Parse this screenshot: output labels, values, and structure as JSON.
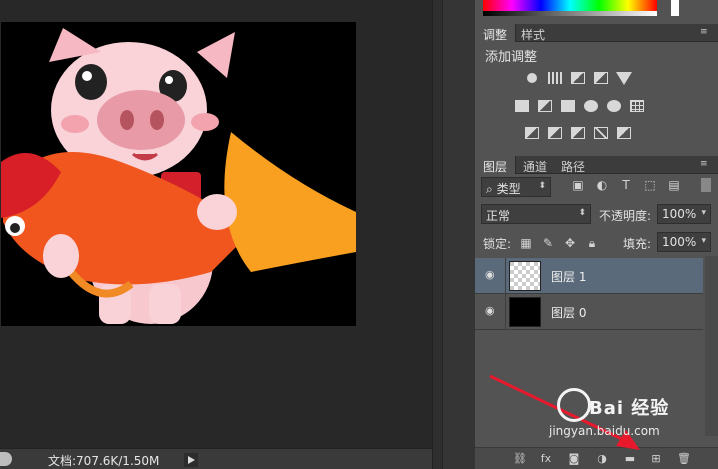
{
  "document": {
    "status_text": "文档:707.6K/1.50M"
  },
  "adjustments_panel": {
    "tabs": [
      {
        "label": "调整"
      },
      {
        "label": "样式"
      }
    ],
    "title": "添加调整"
  },
  "layers_panel": {
    "tabs": [
      {
        "label": "图层"
      },
      {
        "label": "通道"
      },
      {
        "label": "路径"
      }
    ],
    "filter_kind": "类型",
    "blend_mode": "正常",
    "opacity_label": "不透明度:",
    "opacity_value": "100%",
    "lock_label": "锁定:",
    "fill_label": "填充:",
    "fill_value": "100%",
    "layers": [
      {
        "name": "图层 1",
        "selected": true,
        "visible": true
      },
      {
        "name": "图层 0",
        "selected": false,
        "visible": true
      }
    ],
    "footer_fx": "fx"
  },
  "watermark": {
    "main": "Bai 经验",
    "sub": "jingyan.baidu.com"
  },
  "colors": {
    "arrow": "#e8192c",
    "selected_layer": "#5b6a7a",
    "panel_bg": "#535353",
    "canvas_bg": "#000000"
  }
}
